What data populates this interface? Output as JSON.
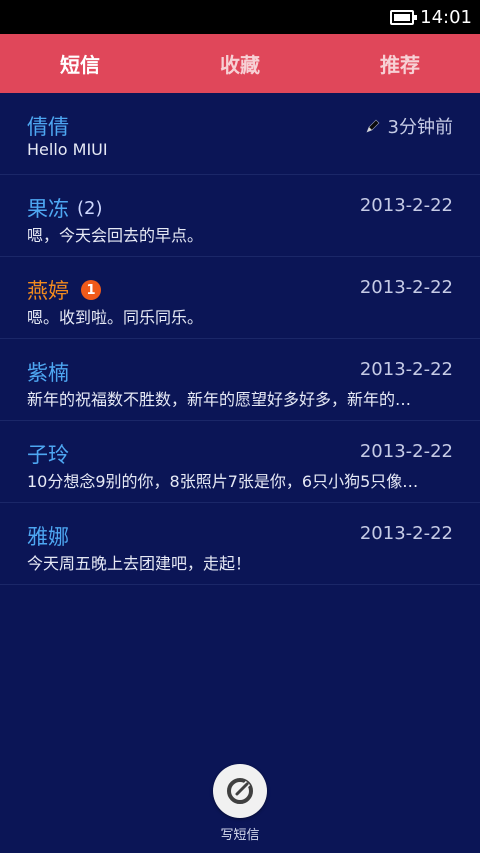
{
  "status_bar": {
    "time": "14:01"
  },
  "tabs": [
    {
      "label": "短信",
      "active": true
    },
    {
      "label": "收藏",
      "active": false
    },
    {
      "label": "推荐",
      "active": false
    }
  ],
  "conversations": [
    {
      "name": "倩倩",
      "count": "",
      "badge": "",
      "date": "3分钟前",
      "preview": "Hello MIUI",
      "draft": true,
      "name_color": "#4ea7f2"
    },
    {
      "name": "果冻",
      "count": "(2)",
      "badge": "",
      "date": "2013-2-22",
      "preview": "嗯，今天会回去的早点。",
      "draft": false,
      "name_color": "#4ea7f2"
    },
    {
      "name": "燕婷",
      "count": "",
      "badge": "1",
      "date": "2013-2-22",
      "preview": "嗯。收到啦。同乐同乐。",
      "draft": false,
      "name_color": "#f28a1e"
    },
    {
      "name": "紫楠",
      "count": "",
      "badge": "",
      "date": "2013-2-22",
      "preview": "新年的祝福数不胜数，新年的愿望好多好多，新年的…",
      "draft": false,
      "name_color": "#4ea7f2"
    },
    {
      "name": "子玲",
      "count": "",
      "badge": "",
      "date": "2013-2-22",
      "preview": "10分想念9别的你，8张照片7张是你，6只小狗5只像…",
      "draft": false,
      "name_color": "#4ea7f2"
    },
    {
      "name": "雅娜",
      "count": "",
      "badge": "",
      "date": "2013-2-22",
      "preview": "今天周五晚上去团建吧，走起！",
      "draft": false,
      "name_color": "#4ea7f2"
    }
  ],
  "compose": {
    "label": "写短信",
    "icon": "compose-icon"
  },
  "colors": {
    "background": "#0b1556",
    "tab_bar": "#e0475a",
    "name_blue": "#4ea7f2",
    "name_orange": "#f28a1e",
    "badge": "#f05a1a"
  }
}
